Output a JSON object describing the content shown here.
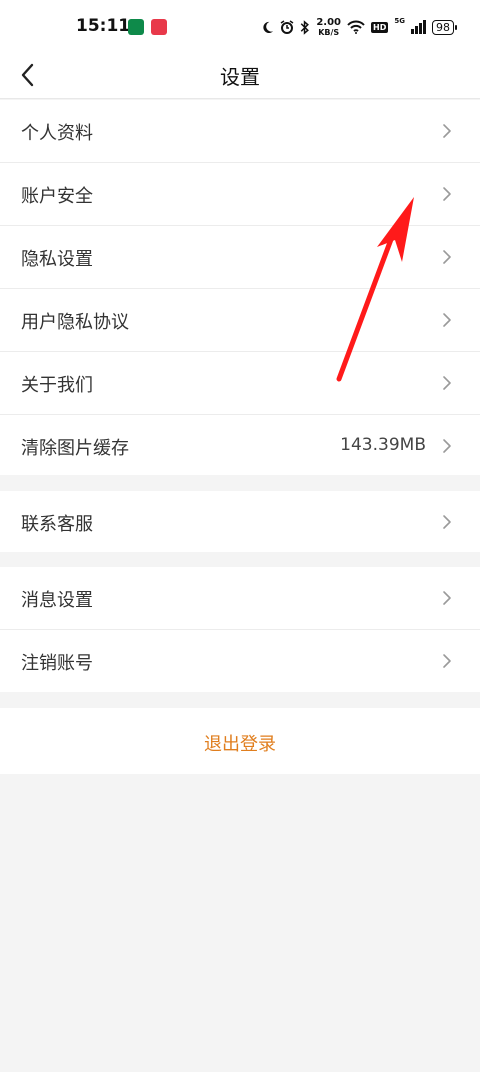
{
  "status_bar": {
    "time": "15:11",
    "net_speed_value": "2.00",
    "net_speed_unit": "KB/S",
    "hd": "HD",
    "network": "5G",
    "battery": "98",
    "icons": [
      "moon-icon",
      "alarm-icon",
      "bluetooth-icon",
      "wifi-icon",
      "signal-icon"
    ]
  },
  "header": {
    "title": "设置"
  },
  "groups": [
    {
      "items": [
        {
          "label": "个人资料"
        },
        {
          "label": "账户安全"
        },
        {
          "label": "隐私设置"
        },
        {
          "label": "用户隐私协议"
        },
        {
          "label": "关于我们"
        },
        {
          "label": "清除图片缓存",
          "value": "143.39MB"
        }
      ]
    },
    {
      "items": [
        {
          "label": "联系客服"
        }
      ]
    },
    {
      "items": [
        {
          "label": "消息设置"
        },
        {
          "label": "注销账号"
        }
      ]
    }
  ],
  "logout_label": "退出登录",
  "colors": {
    "accent": "#e07e1e",
    "annotation": "#ff1a1a",
    "background": "#f4f4f4"
  }
}
